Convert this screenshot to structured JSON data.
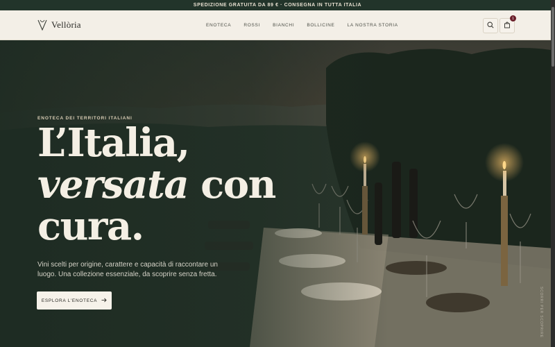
{
  "announcement": "SPEDIZIONE GRATUITA DA 89 € · CONSEGNA IN TUTTA ITALIA",
  "brand": {
    "name": "Vellòria",
    "logo_icon": "wine-glass-v-icon"
  },
  "nav": [
    "ENOTECA",
    "ROSSI",
    "BIANCHI",
    "BOLLICINE",
    "LA NOSTRA STORIA"
  ],
  "header_actions": {
    "search_icon": "search-icon",
    "cart_icon": "shopping-bag-icon",
    "cart_count": "1"
  },
  "hero": {
    "eyebrow": "ENOTECA DEI TERRITORI ITALIANI",
    "headline_line1": "L’Italia,",
    "headline_line2_italic": "versata",
    "headline_line2_rest": " con",
    "headline_line3": "cura.",
    "lede": "Vini scelti per origine, carattere e capacità di raccontare un luogo. Una collezione essenziale, da scoprire senza fretta.",
    "cta_label": "ESPLORA L'ENOTECA",
    "cta_icon": "arrow-right-icon",
    "scroll_hint": "SCORRI PER SCOPRIRE"
  },
  "colors": {
    "topbar": "#22342a",
    "header": "#f3efe7",
    "accent": "#6b1f2a",
    "hero_text": "#f4efe4"
  }
}
